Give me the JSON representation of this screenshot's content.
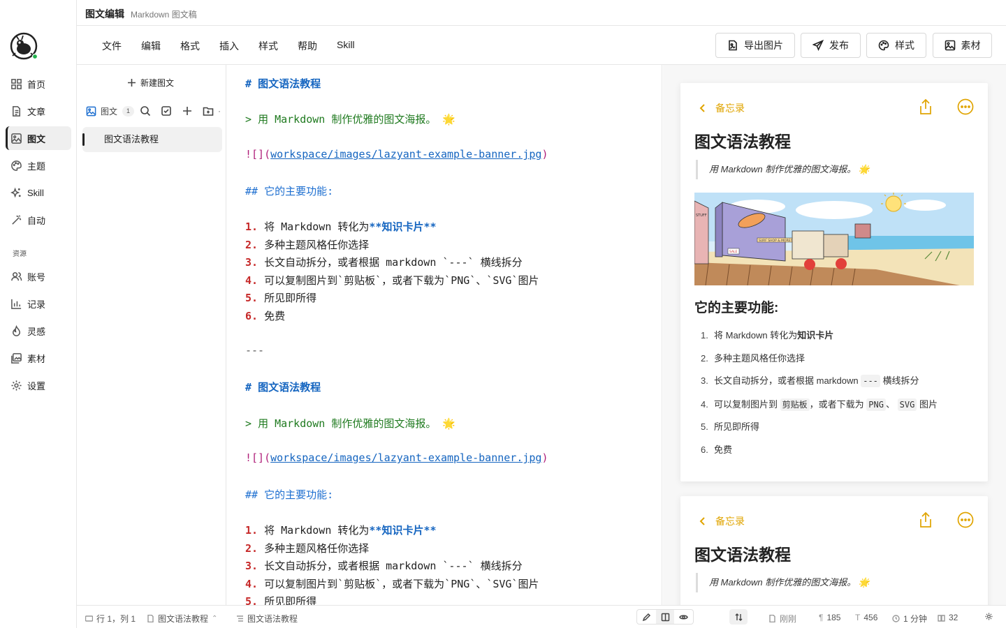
{
  "titlebar": {
    "title": "图文编辑",
    "subtitle": "Markdown 图文稿"
  },
  "nav": {
    "items": [
      {
        "label": "首页",
        "icon": "grid-icon"
      },
      {
        "label": "文章",
        "icon": "document-icon"
      },
      {
        "label": "图文",
        "icon": "image-icon"
      },
      {
        "label": "主题",
        "icon": "palette-icon"
      },
      {
        "label": "Skill",
        "icon": "sparkle-icon"
      },
      {
        "label": "自动",
        "icon": "magic-wand-icon"
      }
    ],
    "section_label": "资源",
    "resources": [
      {
        "label": "账号",
        "icon": "users-icon"
      },
      {
        "label": "记录",
        "icon": "bar-chart-icon"
      },
      {
        "label": "灵感",
        "icon": "flame-icon"
      },
      {
        "label": "素材",
        "icon": "gallery-icon"
      },
      {
        "label": "设置",
        "icon": "gear-icon"
      }
    ]
  },
  "menu": {
    "items": [
      "文件",
      "编辑",
      "格式",
      "插入",
      "样式",
      "帮助",
      "Skill"
    ]
  },
  "toolbar": {
    "export": "导出图片",
    "publish": "发布",
    "style": "样式",
    "assets": "素材"
  },
  "panel": {
    "new_doc": "新建图文",
    "tab_label": "图文",
    "count": "1",
    "doc_title": "图文语法教程"
  },
  "editor": {
    "h1_mark": "#",
    "h1_text": "图文语法教程",
    "quote_mark": ">",
    "quote_text": "用 Markdown 制作优雅的图文海报。 🌟",
    "img_open": "![](",
    "img_url": "workspace/images/lazyant-example-banner.jpg",
    "img_close": ")",
    "h2_mark": "##",
    "h2_text": "它的主要功能:",
    "item1_prefix": "将 Markdown 转化为",
    "item1_bold": "**知识卡片**",
    "items": [
      "多种主题风格任你选择",
      "长文自动拆分，或者根据 markdown `---` 横线拆分",
      "可以复制图片到`剪贴板`，或者下载为`PNG`、`SVG`图片",
      "所见即所得",
      "免费"
    ],
    "numbers": [
      "1.",
      "2.",
      "3.",
      "4.",
      "5.",
      "6."
    ],
    "hr": "---"
  },
  "preview": {
    "back_label": "备忘录",
    "title": "图文语法教程",
    "quote": "用 Markdown 制作优雅的图文海报。 🌟",
    "heading": "它的主要功能:",
    "list_nums": [
      "1.",
      "2.",
      "3.",
      "4.",
      "5.",
      "6."
    ],
    "li1_a": "将 Markdown 转化为",
    "li1_b": "知识卡片",
    "li2": "多种主题风格任你选择",
    "li3_a": "长文自动拆分，或者根据 markdown",
    "li3_code": "---",
    "li3_b": "横线拆分",
    "li4_a": "可以复制图片到",
    "li4_c1": "剪贴板",
    "li4_b": "，或者下载为",
    "li4_c2": "PNG",
    "li4_sep": "、",
    "li4_c3": "SVG",
    "li4_d": "图片",
    "li5": "所见即所得",
    "li6": "免费",
    "banner_signs": {
      "shop": "SURF SHOP & MORE!",
      "left": "STUFF",
      "sale": "SALE"
    }
  },
  "status": {
    "position": "行 1，列 1",
    "file": "图文语法教程",
    "outline": "图文语法教程",
    "saved": "刚刚",
    "paragraphs": "185",
    "chars": "456",
    "read_time": "1 分钟",
    "pages": "32"
  },
  "colors": {
    "accent": "#e0a400",
    "h1": "#1565c0",
    "list_num": "#c62828",
    "quote": "#1f7a1f",
    "link": "#b0207a"
  }
}
